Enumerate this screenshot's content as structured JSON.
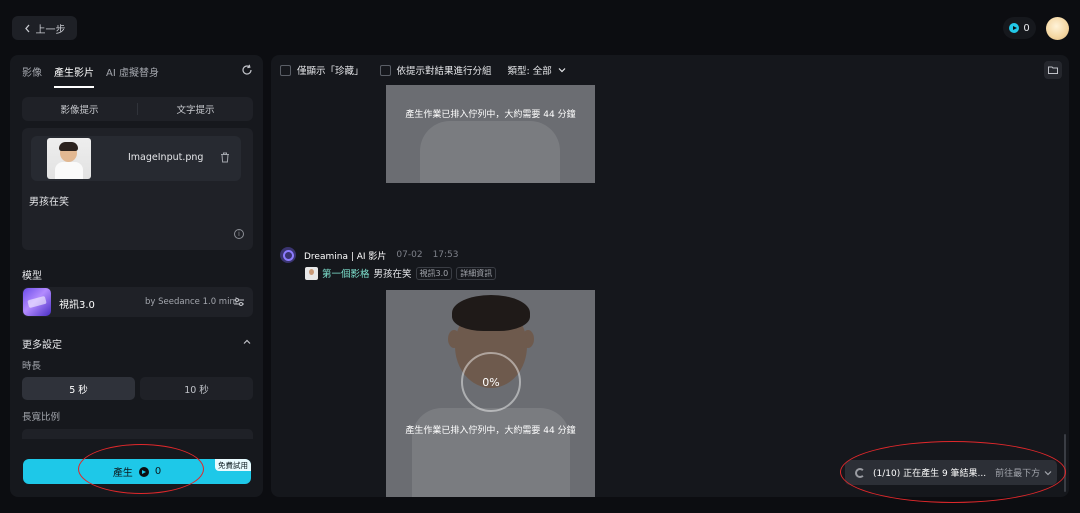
{
  "topbar": {
    "back_label": "上一步",
    "credits": "0"
  },
  "sidebar": {
    "tabs": [
      "影像",
      "產生影片",
      "AI 虛擬替身"
    ],
    "prompt_modes": [
      "影像提示",
      "文字提示"
    ],
    "file_name": "ImageInput.png",
    "prompt_text": "男孩在笑",
    "model_section_label": "模型",
    "model_name": "視訊3.0",
    "model_by": "by Seedance 1.0 mini",
    "more_settings_label": "更多設定",
    "duration_label": "時長",
    "duration_options": [
      "5 秒",
      "10 秒"
    ],
    "duration_selected": "5 秒",
    "aspect_ratio_label": "長寬比例",
    "generate_label": "產生",
    "generate_cost": "0",
    "trial_badge": "免費試用"
  },
  "feed": {
    "filters": {
      "favorites_only": "僅顯示「珍藏」",
      "group_by_prompt": "依提示對結果進行分組",
      "type_label": "類型: 全部"
    },
    "queue_message": "產生作業已排入佇列中，大約需要 44 分鐘",
    "message": {
      "sender": "Dreamina | AI 影片",
      "date": "07-02",
      "time": "17:53",
      "reference_label": "第一個影格",
      "prompt": "男孩在笑",
      "model_chip": "視訊3.0",
      "details_chip": "詳細資訊"
    },
    "progress_text": "0%"
  },
  "status_bar": {
    "progress_text": "(1/10) 正在產生 9 筆結果...",
    "jump_label": "前往最下方"
  },
  "colors": {
    "accent": "#1ec8e8",
    "background": "#0c0d11",
    "panel": "#16181d",
    "annotation": "#e0282b"
  }
}
